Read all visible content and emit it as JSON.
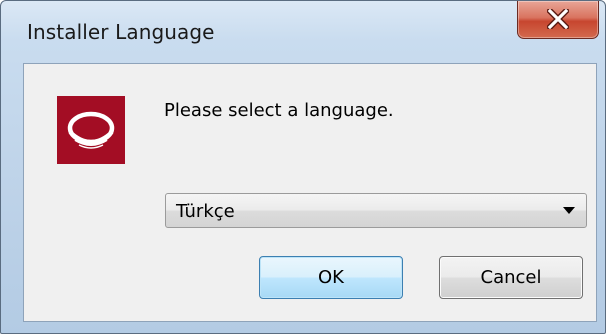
{
  "window": {
    "title": "Installer Language",
    "close_icon": "close-icon"
  },
  "dialog": {
    "logo_icon": "installer-logo-icon",
    "logo_color": "#a30d24",
    "prompt": "Please select a language.",
    "language_select": {
      "selected": "Türkçe"
    },
    "buttons": {
      "ok_label": "OK",
      "cancel_label": "Cancel"
    }
  }
}
